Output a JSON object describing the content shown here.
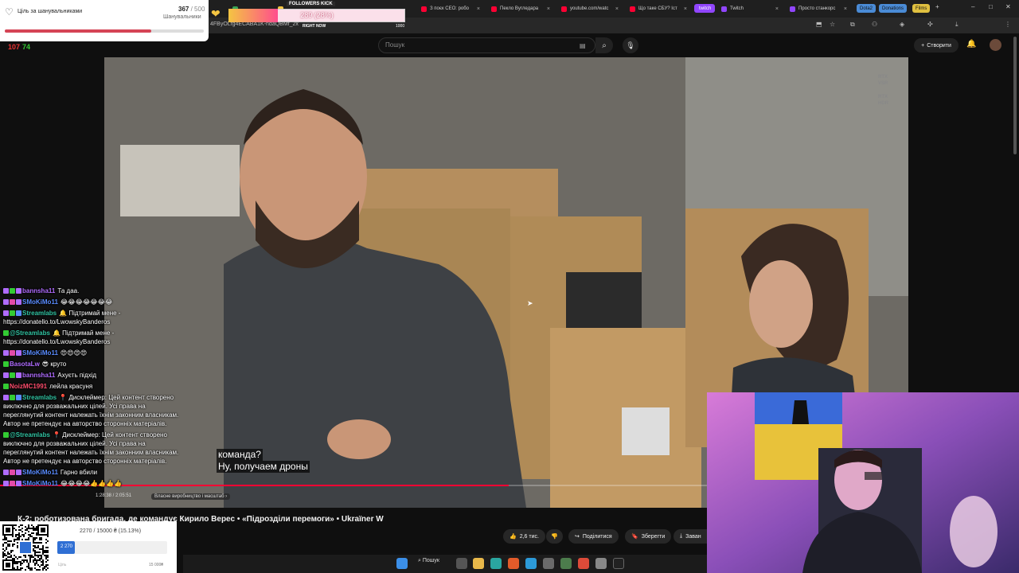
{
  "browser": {
    "tabs": [
      {
        "label": "",
        "color": "#3aa655"
      },
      {
        "label": "",
        "color": "#f4c542"
      },
      {
        "label": "З поєк CEO: робо",
        "color": "#ff0033"
      },
      {
        "label": "Пекло Вугледара",
        "color": "#ff0033"
      },
      {
        "label": "youtube.com/watc",
        "color": "#ff0033"
      },
      {
        "label": "Що таке СБУ? Іст",
        "color": "#ff0033"
      },
      {
        "label": "twitch",
        "color": "#9146ff"
      },
      {
        "label": "Twitch",
        "color": "#9146ff"
      },
      {
        "label": "Просто станкорс",
        "color": "#9146ff"
      }
    ],
    "pills": [
      {
        "label": "Dota2",
        "color": "#4a8bd6"
      },
      {
        "label": "Donations",
        "color": "#4a8bd6"
      },
      {
        "label": "Films",
        "color": "#e0c040"
      }
    ],
    "close_tab_glyph": "×",
    "new_tab_glyph": "+",
    "window_controls": [
      "–",
      "□",
      "✕"
    ],
    "address_fragment": "4FByOLfg4ECABA1K-ndaQBMf_2x"
  },
  "youtube": {
    "search_placeholder": "Пошук",
    "create_label": "Створити",
    "video": {
      "rtx_vsr": "RTX\nVSR",
      "rtx_hdr": "RTX\nHDR",
      "subtitle_line1": "команда?",
      "subtitle_line2": "Ну, получаем дроны",
      "progress_fraction": 0.72,
      "time_display": "1:28:38 / 2:05:51",
      "chapter_label": "Власне виробництво і масштаб ›",
      "title": "К-2: роботизована бригада, де командує Кирило Верес • «Підрозділи перемоги» • Ukraїner W"
    },
    "actions": {
      "like_count": "2,6 тис.",
      "share_label": "Поділитися",
      "save_label": "Зберегти",
      "download_label": "Заван"
    }
  },
  "overlay_counter": {
    "a": "107",
    "b": "74"
  },
  "goal_widget": {
    "title": "Ціль за шанувальниками",
    "current": "367",
    "total": "/ 500",
    "subtitle": "Шанувальники",
    "fraction": 0.734
  },
  "followers_kick": {
    "title": "FOLLOWERS KICK",
    "value_text": "289 (28%)",
    "fraction": 0.28,
    "right_now": "RIGHT NOW",
    "max": "1000"
  },
  "chat": [
    {
      "user": "bannsha11",
      "color": "#b06cff",
      "text": "Та даа.",
      "badges": [
        "#b06cff",
        "#3c3",
        "#b06cff"
      ]
    },
    {
      "user": "SMoKiMo11",
      "color": "#5a8cff",
      "text": "😂😂😂😂😂😂😂",
      "badges": [
        "#b06cff",
        "#e34ba9",
        "#b06cff"
      ]
    },
    {
      "user": "Streamlabs",
      "color": "#31c3a2",
      "text": "🔔 Підтримай мене - https://donatello.to/LwowskyBanderos",
      "badges": [
        "#b06cff",
        "#3c3",
        "#5a8cff"
      ]
    },
    {
      "user": "@Streamlabs",
      "color": "#31c3a2",
      "text": "🔔 Підтримай мене - https://donatello.to/LwowskyBanderos",
      "badges": [
        "#3c3"
      ]
    },
    {
      "user": "SMoKiMo11",
      "color": "#5a8cff",
      "text": "😍😍😍😍",
      "badges": [
        "#b06cff",
        "#e34ba9",
        "#b06cff"
      ]
    },
    {
      "user": "BasotaLw",
      "color": "#b06cff",
      "text": "😎 круто",
      "badges": [
        "#3c3"
      ]
    },
    {
      "user": "bannsha11",
      "color": "#b06cff",
      "text": "Ахуєть підхід",
      "badges": [
        "#b06cff",
        "#3c3",
        "#b06cff"
      ]
    },
    {
      "user": "NoizMC1991",
      "color": "#ff4d6d",
      "text": "лейла красуня",
      "badges": [
        "#3c3"
      ]
    },
    {
      "user": "Streamlabs",
      "color": "#31c3a2",
      "text": "📍 Дисклеймер: Цей контент створено виключно для розважальних цілей. Усі права на переглянутий контент належать їхнім законним власникам. Автор не претендує на авторство сторонніх матеріалів.",
      "badges": [
        "#b06cff",
        "#3c3",
        "#5a8cff"
      ]
    },
    {
      "user": "@Streamlabs",
      "color": "#31c3a2",
      "text": "📍 Дисклеймер: Цей контент створено виключно для розважальних цілей. Усі права на переглянутий контент належать їхнім законним власникам. Автор не претендує на авторство сторонніх матеріалів.",
      "badges": [
        "#3c3"
      ]
    },
    {
      "user": "SMoKiMo11",
      "color": "#5a8cff",
      "text": "Гарно вбили",
      "badges": [
        "#b06cff",
        "#e34ba9",
        "#b06cff"
      ]
    },
    {
      "user": "SMoKiMo11",
      "color": "#5a8cff",
      "text": "😂😂😂😂👍👍👍👍",
      "badges": [
        "#b06cff",
        "#e34ba9",
        "#b06cff"
      ]
    }
  ],
  "donation": {
    "title": "2270 / 15000 ₴ (15.13%)",
    "current": "2 270",
    "fraction": 0.1513,
    "label": "Ціль",
    "max": "15 000₴"
  },
  "taskbar": {
    "search_label": "Пошук"
  },
  "colors": {
    "accent": "#ff0033",
    "kick_pink": "#ff4d8d",
    "goal_red": "#d54455"
  }
}
